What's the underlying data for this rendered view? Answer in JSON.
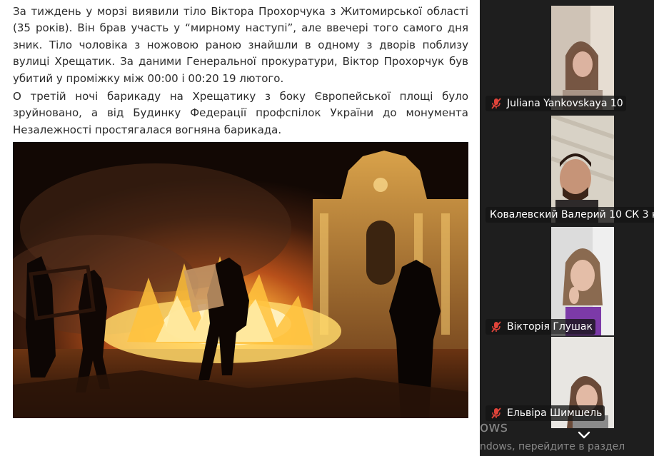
{
  "document": {
    "paragraph_1": "За тиждень у морзі виявили тіло Віктора Прохорчука з Житомирської області (35 років). Він брав участь у “мирному наступі”, але ввечері того самого дня зник. Тіло чоловіка з ножовою раною знайшли в одному з дворів поблизу вулиці Хрещатик. За даними Генеральної прокуратури, Віктор Прохорчук був убитий у проміжку між 00:00 і 00:20 19 лютого.",
    "paragraph_2": "О третій ночі барикаду на Хрещатику з боку Європейської площі було зруйновано, а від Будинку Федерації профспілок України до монумента Незалежності простягалася вогняна барикада.",
    "photo": "Maidan night barricade fire photo"
  },
  "call_panel": {
    "participants": [
      {
        "name": "Juliana Yankovskaya 10",
        "mic_muted": true
      },
      {
        "name": "Ковалевский Валерий 10 СК 3 к",
        "mic_muted": false
      },
      {
        "name": "Вікторія Глушак",
        "mic_muted": true
      },
      {
        "name": "Ельвіра Шимшель",
        "mic_muted": true
      }
    ],
    "collapse_icon": "chevron-down-icon",
    "muted_color": "#e0443a"
  },
  "watermark": {
    "line_1": "ows",
    "line_2": "ndows, перейдите в раздел"
  }
}
